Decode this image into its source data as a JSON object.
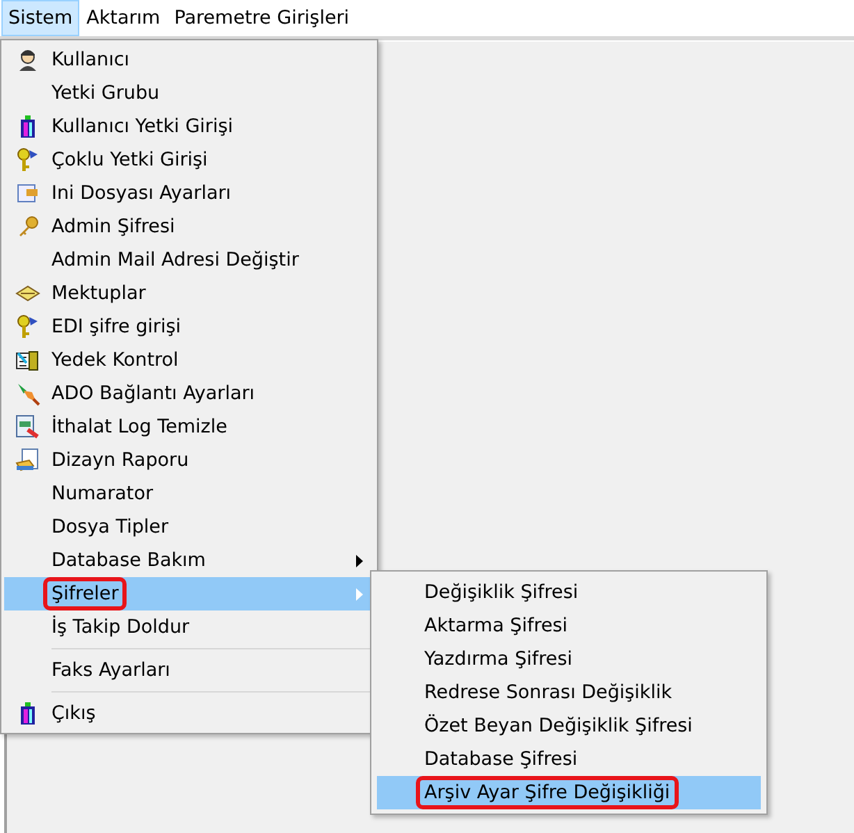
{
  "menubar": [
    {
      "label": "Sistem",
      "selected": true
    },
    {
      "label": "Aktarım",
      "selected": false
    },
    {
      "label": "Paremetre Girişleri",
      "selected": false
    }
  ],
  "menu": [
    {
      "label": "Kullanıcı",
      "kind": "person",
      "selected": false,
      "submenu": false,
      "annotated": false,
      "separator_before": false
    },
    {
      "label": "Yetki Grubu",
      "kind": "plain",
      "selected": false,
      "submenu": false,
      "annotated": false,
      "separator_before": false
    },
    {
      "label": "Kullanıcı Yetki Girişi",
      "kind": "tower",
      "selected": false,
      "submenu": false,
      "annotated": false,
      "separator_before": false
    },
    {
      "label": "Çoklu Yetki Girişi",
      "kind": "keyring",
      "selected": false,
      "submenu": false,
      "annotated": false,
      "separator_before": false
    },
    {
      "label": "Ini Dosyası  Ayarları",
      "kind": "ini",
      "selected": false,
      "submenu": false,
      "annotated": false,
      "separator_before": false
    },
    {
      "label": "Admin Şifresi",
      "kind": "key",
      "selected": false,
      "submenu": false,
      "annotated": false,
      "separator_before": false
    },
    {
      "label": "Admin Mail Adresi Değiştir",
      "kind": "plain",
      "selected": false,
      "submenu": false,
      "annotated": false,
      "separator_before": false
    },
    {
      "label": "Mektuplar",
      "kind": "envelope",
      "selected": false,
      "submenu": false,
      "annotated": false,
      "separator_before": false
    },
    {
      "label": "EDI şifre girişi",
      "kind": "keyring",
      "selected": false,
      "submenu": false,
      "annotated": false,
      "separator_before": false
    },
    {
      "label": "Yedek Kontrol",
      "kind": "backup",
      "selected": false,
      "submenu": false,
      "annotated": false,
      "separator_before": false
    },
    {
      "label": "ADO Bağlantı Ayarları",
      "kind": "plug",
      "selected": false,
      "submenu": false,
      "annotated": false,
      "separator_before": false
    },
    {
      "label": "İthalat Log Temizle",
      "kind": "log",
      "selected": false,
      "submenu": false,
      "annotated": false,
      "separator_before": false
    },
    {
      "label": "Dizayn Raporu",
      "kind": "report",
      "selected": false,
      "submenu": false,
      "annotated": false,
      "separator_before": false
    },
    {
      "label": "Numarator",
      "kind": "plain",
      "selected": false,
      "submenu": false,
      "annotated": false,
      "separator_before": false
    },
    {
      "label": "Dosya Tipler",
      "kind": "plain",
      "selected": false,
      "submenu": false,
      "annotated": false,
      "separator_before": false
    },
    {
      "label": "Database Bakım",
      "kind": "plain",
      "selected": false,
      "submenu": true,
      "annotated": false,
      "separator_before": false
    },
    {
      "label": "Şifreler",
      "kind": "plain",
      "selected": true,
      "submenu": true,
      "annotated": true,
      "separator_before": false
    },
    {
      "label": "İş Takip Doldur",
      "kind": "plain",
      "selected": false,
      "submenu": false,
      "annotated": false,
      "separator_before": false
    },
    {
      "label": "Faks Ayarları",
      "kind": "plain",
      "selected": false,
      "submenu": false,
      "annotated": false,
      "separator_before": true
    },
    {
      "label": "Çıkış",
      "kind": "tower",
      "selected": false,
      "submenu": false,
      "annotated": false,
      "separator_before": true
    }
  ],
  "submenu": [
    {
      "label": "Değişiklik Şifresi",
      "selected": false,
      "annotated": false
    },
    {
      "label": "Aktarma Şifresi",
      "selected": false,
      "annotated": false
    },
    {
      "label": "Yazdırma Şifresi",
      "selected": false,
      "annotated": false
    },
    {
      "label": "Redrese Sonrası Değişiklik",
      "selected": false,
      "annotated": false
    },
    {
      "label": "Özet Beyan Değişiklik Şifresi",
      "selected": false,
      "annotated": false
    },
    {
      "label": "Database Şifresi",
      "selected": false,
      "annotated": false
    },
    {
      "label": "Arşiv Ayar Şifre Değişikliği",
      "selected": true,
      "annotated": true
    }
  ]
}
